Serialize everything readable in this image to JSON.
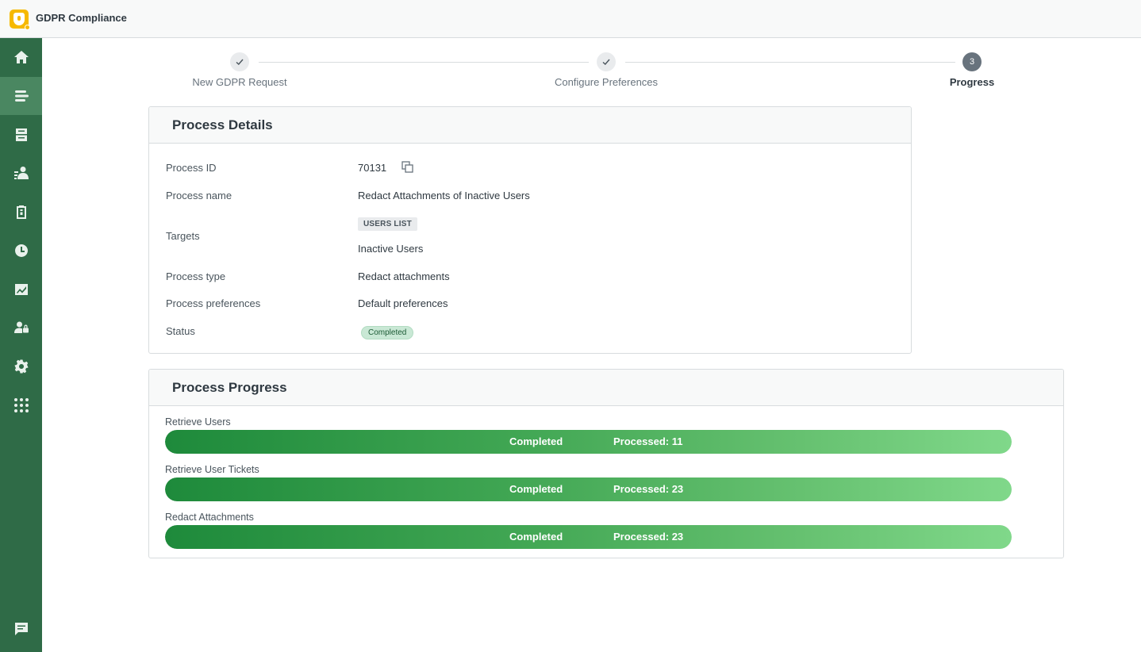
{
  "app": {
    "title": "GDPR Compliance",
    "logo_icon": "shield-user-icon",
    "accent": "#f6b900"
  },
  "sidebar": {
    "bg": "#2f6b47",
    "items": [
      {
        "icon": "home-icon",
        "active": false
      },
      {
        "icon": "requests-icon",
        "active": true
      },
      {
        "icon": "archive-icon",
        "active": false
      },
      {
        "icon": "user-list-icon",
        "active": false
      },
      {
        "icon": "clipboard-icon",
        "active": false
      },
      {
        "icon": "clock-icon",
        "active": false
      },
      {
        "icon": "chart-icon",
        "active": false
      },
      {
        "icon": "user-lock-icon",
        "active": false
      },
      {
        "icon": "gear-icon",
        "active": false
      },
      {
        "icon": "apps-grid-icon",
        "active": false
      },
      {
        "icon": "chat-icon",
        "active": false
      }
    ]
  },
  "stepper": {
    "steps": [
      {
        "label": "New GDPR Request",
        "state": "done"
      },
      {
        "label": "Configure Preferences",
        "state": "done"
      },
      {
        "label": "Progress",
        "state": "current",
        "number": "3"
      }
    ]
  },
  "details": {
    "title": "Process Details",
    "process_id_label": "Process ID",
    "process_id": "70131",
    "process_name_label": "Process name",
    "process_name": "Redact Attachments of Inactive Users",
    "targets_label": "Targets",
    "targets_tag": "USERS LIST",
    "targets_link": "Inactive Users",
    "process_type_label": "Process type",
    "process_type": "Redact attachments",
    "process_preferences_label": "Process preferences",
    "process_preferences": "Default preferences",
    "status_label": "Status",
    "status": "Completed"
  },
  "progress": {
    "title": "Process Progress",
    "items": [
      {
        "label": "Retrieve Users",
        "status": "Completed",
        "processed": "Processed: 11",
        "fraction": 1.0
      },
      {
        "label": "Retrieve User Tickets",
        "status": "Completed",
        "processed": "Processed: 23",
        "fraction": 1.0
      },
      {
        "label": "Redact Attachments",
        "status": "Completed",
        "processed": "Processed: 23",
        "fraction": 1.0
      }
    ]
  }
}
